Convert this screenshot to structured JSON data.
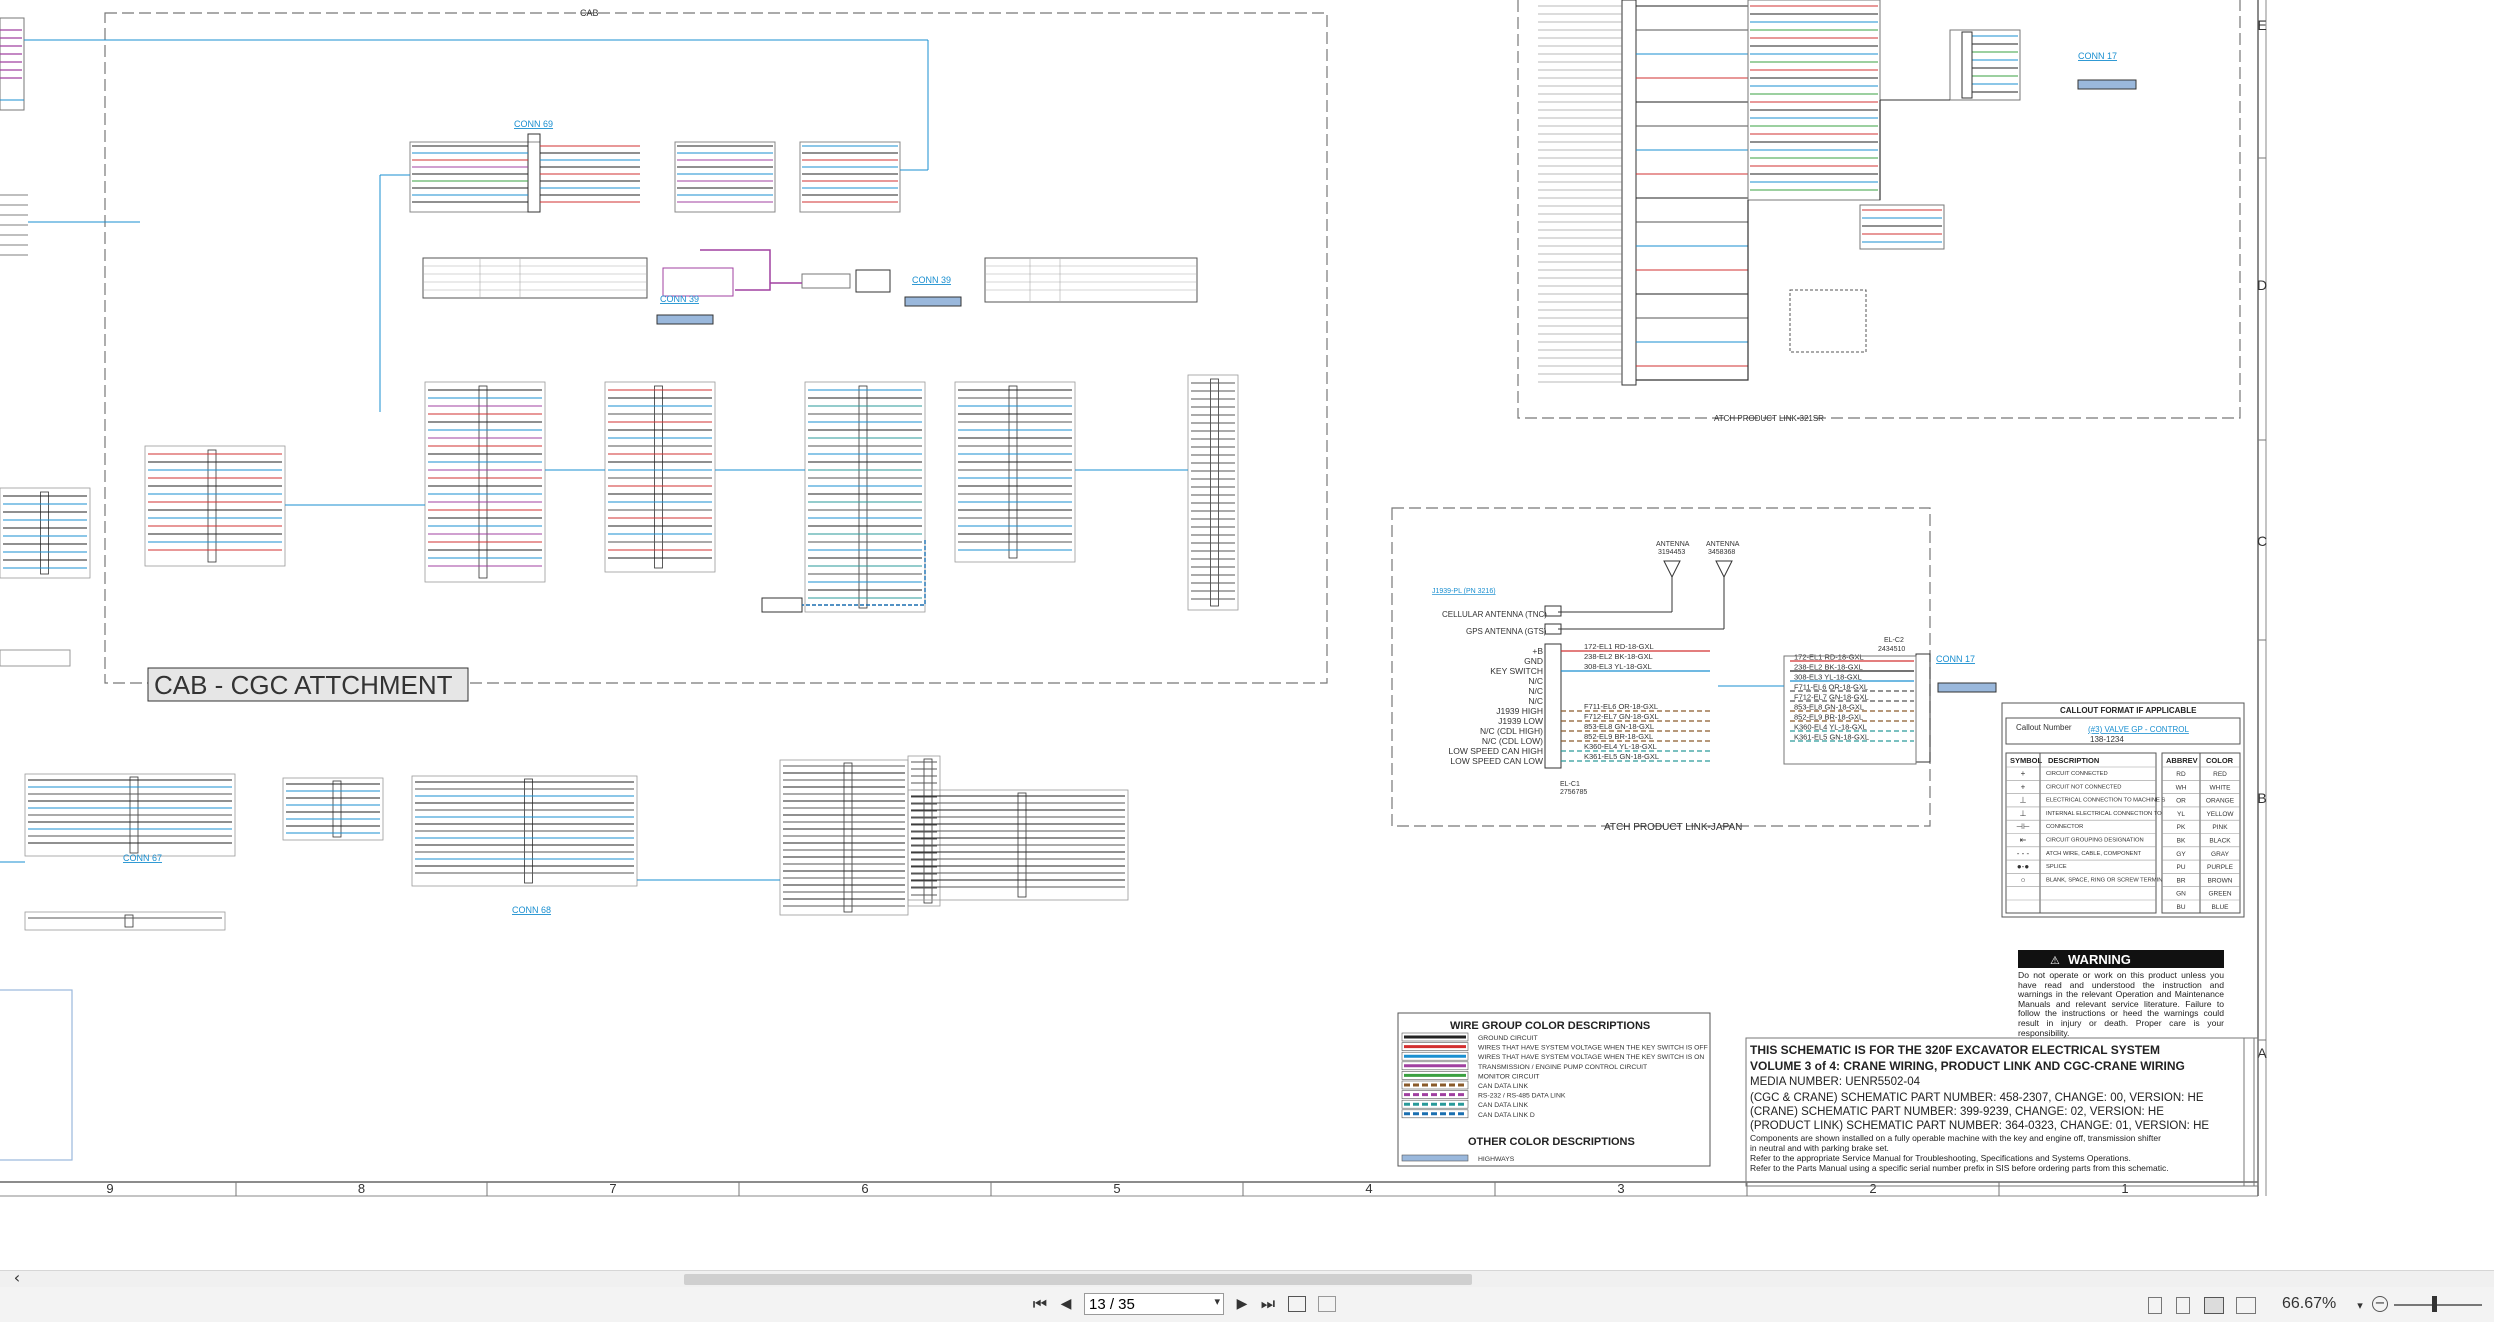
{
  "viewer": {
    "current_page": "13 / 35",
    "zoom": "66.67%",
    "nav": {
      "first": "⏮",
      "prev": "◀",
      "next": "▶",
      "last": "⏭"
    },
    "scroll_left": "‹"
  },
  "sheet": {
    "col_numbers": [
      "9",
      "8",
      "7",
      "6",
      "5",
      "4",
      "3",
      "2",
      "1"
    ],
    "row_letters": [
      "E",
      "D",
      "C",
      "B",
      "A"
    ],
    "zones": {
      "cab_label": "CAB",
      "cgc_title": "CAB - CGC ATTCHMENT",
      "atch_upper_label": "ATCH PRODUCT LINK-321SR",
      "atch_japan_label": "ATCH PRODUCT LINK-JAPAN"
    },
    "connectors": {
      "conn69": "CONN 69",
      "conn39a": "CONN 39",
      "conn39b": "CONN 39",
      "conn67": "CONN 67",
      "conn68": "CONN 68",
      "conn17a": "CONN 17",
      "conn17b": "CONN 17"
    },
    "antennas": {
      "a1": "ANTENNA",
      "a1_part": "3194453",
      "a2": "ANTENNA",
      "a2_part": "3458368",
      "cellular": "CELLULAR ANTENNA (TNC)",
      "gps": "GPS ANTENNA (GTS)",
      "elc2": "EL-C2",
      "elc2_part": "2434510",
      "elc1": "EL-C1",
      "elc1_part": "2756785"
    },
    "japan_pins": [
      "+B",
      "GND",
      "KEY SWITCH",
      "N/C",
      "N/C",
      "N/C",
      "J1939 HIGH",
      "J1939 LOW",
      "N/C (CDL HIGH)",
      "N/C (CDL LOW)",
      "LOW SPEED CAN HIGH",
      "LOW SPEED CAN LOW"
    ],
    "japan_wires": [
      "172-EL1 RD-18-GXL",
      "238-EL2 BK-18-GXL",
      "308-EL3 YL-18-GXL",
      "F711-EL6 OR-18-GXL",
      "F712-EL7 GN-18-GXL",
      "853-EL8 GN-18-GXL",
      "852-EL9 BR-18-GXL",
      "K360-EL4 YL-18-GXL",
      "K361-EL5 GN-18-GXL"
    ],
    "callout": {
      "title": "CALLOUT FORMAT IF APPLICABLE",
      "callout_number": "Callout Number",
      "callout_example": "(#3) VALVE GP - CONTROL",
      "part_example": "138-1234",
      "headers": [
        "SYMBOL",
        "DESCRIPTION",
        "ABBREV",
        "COLOR"
      ],
      "rows": [
        {
          "desc": "CIRCUIT CONNECTED",
          "abbrev": "RD",
          "color": "RED"
        },
        {
          "desc": "CIRCUIT NOT CONNECTED",
          "abbrev": "WH",
          "color": "WHITE"
        },
        {
          "desc": "ELECTRICAL CONNECTION TO MACHINE STRUCTURE",
          "abbrev": "OR",
          "color": "ORANGE"
        },
        {
          "desc": "INTERNAL ELECTRICAL CONNECTION TO SURFACE OF COMPONENT",
          "abbrev": "YL",
          "color": "YELLOW"
        },
        {
          "desc": "CONNECTOR",
          "abbrev": "PK",
          "color": "PINK"
        },
        {
          "desc": "CIRCUIT GROUPING DESIGNATION",
          "abbrev": "BK",
          "color": "BLACK"
        },
        {
          "desc": "ATCH WIRE, CABLE, COMPONENT",
          "abbrev": "GY",
          "color": "GRAY"
        },
        {
          "desc": "SPLICE",
          "abbrev": "PU",
          "color": "PURPLE"
        },
        {
          "desc": "BLANK, SPACE, RING OR SCREW TERMINAL",
          "abbrev": "BR",
          "color": "BROWN"
        },
        {
          "desc": "",
          "abbrev": "GN",
          "color": "GREEN"
        },
        {
          "desc": "",
          "abbrev": "BU",
          "color": "BLUE"
        }
      ]
    },
    "warning": {
      "title": "WARNING",
      "text": "Do not operate or work on this product unless you have read and understood the instruction and warnings in the relevant Operation and Maintenance Manuals and relevant service literature. Failure to follow the instructions or heed the warnings could result in injury or death. Proper care is your responsibility."
    },
    "wire_groups": {
      "title": "WIRE GROUP COLOR DESCRIPTIONS",
      "rows": [
        {
          "label": "GROUND CIRCUIT",
          "color": "#222222"
        },
        {
          "label": "WIRES THAT HAVE SYSTEM VOLTAGE WHEN THE KEY SWITCH IS OFF",
          "color": "#d23030"
        },
        {
          "label": "WIRES THAT HAVE SYSTEM VOLTAGE WHEN THE KEY SWITCH IS ON",
          "color": "#1a8fd0"
        },
        {
          "label": "TRANSMISSION / ENGINE PUMP CONTROL CIRCUIT",
          "color": "#a040a0"
        },
        {
          "label": "MONITOR CIRCUIT",
          "color": "#3aa040"
        },
        {
          "label": "CAN DATA LINK",
          "color": "#8a5a2a"
        },
        {
          "label": "RS-232 / RS-485 DATA LINK",
          "color": "#a040a0"
        },
        {
          "label": "CAN DATA LINK",
          "color": "#2a9a9a"
        },
        {
          "label": "CAN DATA LINK D",
          "color": "#1a6fb0"
        }
      ],
      "other_title": "OTHER COLOR DESCRIPTIONS",
      "other_rows": [
        {
          "label": "HIGHWAYS",
          "color": "#9ab8dc"
        }
      ]
    },
    "title_block": {
      "line1": "THIS SCHEMATIC IS FOR THE 320F EXCAVATOR ELECTRICAL SYSTEM",
      "line2": "VOLUME 3 of 4: CRANE WIRING, PRODUCT LINK AND CGC-CRANE WIRING",
      "line3": "MEDIA NUMBER: UENR5502-04",
      "line4": "(CGC & CRANE) SCHEMATIC PART NUMBER: 458-2307, CHANGE: 00, VERSION: HE",
      "line5": "(CRANE) SCHEMATIC PART NUMBER: 399-9239, CHANGE: 02, VERSION: HE",
      "line6": "(PRODUCT LINK) SCHEMATIC PART NUMBER: 364-0323, CHANGE: 01, VERSION: HE",
      "line7": "Components are shown installed on a fully operable machine with the key and engine off, transmission shifter",
      "line8": "in neutral and with parking brake set.",
      "line9": "Refer to the appropriate Service Manual for Troubleshooting, Specifications and Systems Operations.",
      "line10": "Refer to the Parts Manual using a specific serial number prefix in SIS before ordering parts from this schematic."
    }
  }
}
